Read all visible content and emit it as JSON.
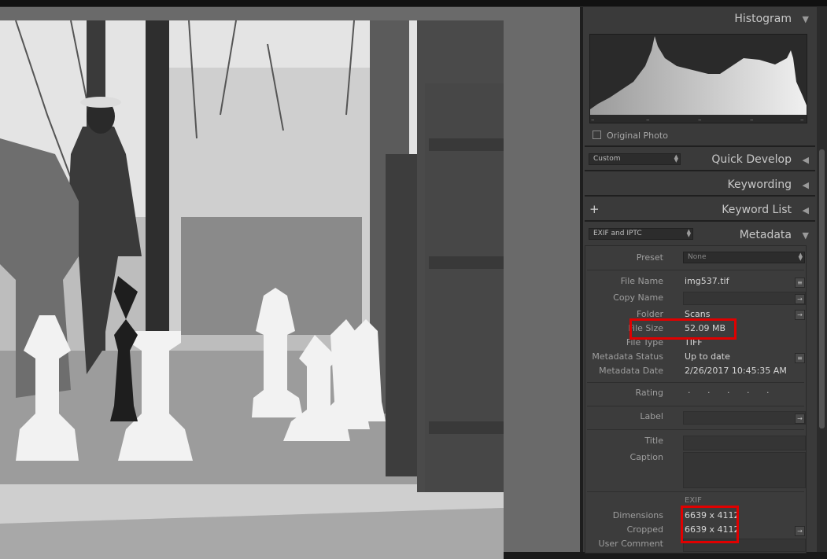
{
  "sections": {
    "histogram": {
      "title": "Histogram",
      "arrow": "▼",
      "original_photo_label": "Original Photo",
      "ticks": [
        "–",
        "–",
        "–",
        "–",
        "–"
      ]
    },
    "quick_develop": {
      "title": "Quick Develop",
      "arrow": "◀",
      "preset": "Custom"
    },
    "keywording": {
      "title": "Keywording",
      "arrow": "◀"
    },
    "keyword_list": {
      "title": "Keyword List",
      "arrow": "◀",
      "plus": "+"
    },
    "metadata": {
      "title": "Metadata",
      "arrow": "▼",
      "view": "EXIF and IPTC"
    }
  },
  "metadata": {
    "preset_label": "Preset",
    "preset_value": "None",
    "file_name_label": "File Name",
    "file_name": "img537.tif",
    "copy_name_label": "Copy Name",
    "copy_name": "",
    "folder_label": "Folder",
    "folder": "Scans",
    "file_size_label": "File Size",
    "file_size": "52.09 MB",
    "file_type_label": "File Type",
    "file_type": "TIFF",
    "metadata_status_label": "Metadata Status",
    "metadata_status": "Up to date",
    "metadata_date_label": "Metadata Date",
    "metadata_date": "2/26/2017 10:45:35 AM",
    "rating_label": "Rating",
    "rating": "· · · · ·",
    "label_label": "Label",
    "title_label": "Title",
    "caption_label": "Caption",
    "exif_header": "EXIF",
    "dimensions_label": "Dimensions",
    "dimensions": "6639 x 4112",
    "cropped_label": "Cropped",
    "cropped": "6639 x 4112",
    "user_comment_label": "User Comment"
  },
  "colors": {
    "highlight": "#e00000",
    "panel": "#3a3a3a",
    "canvas": "#6a6a6a"
  }
}
